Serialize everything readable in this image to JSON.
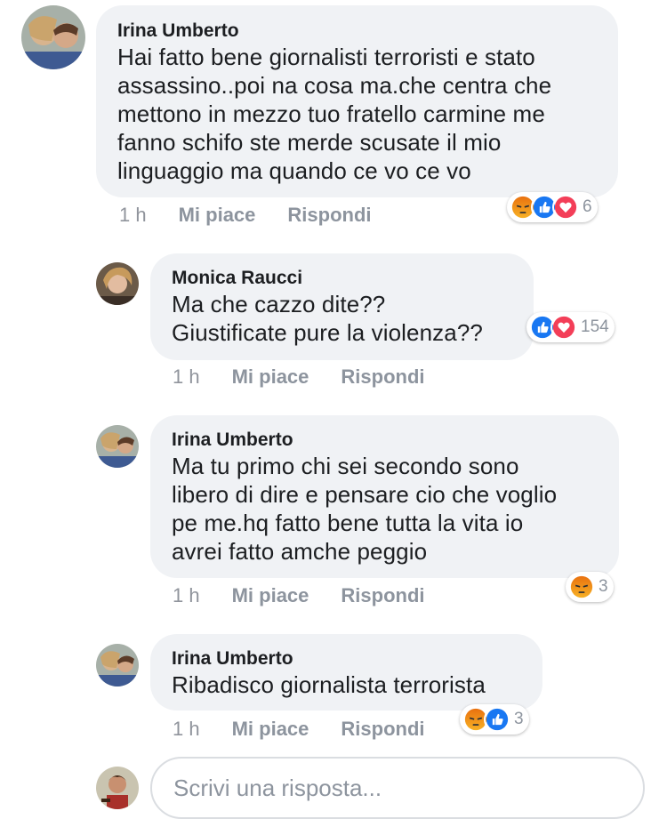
{
  "comments": [
    {
      "author": "Irina Umberto",
      "text": "Hai fatto bene giornalisti terroristi e stato\nassassino..poi na cosa ma.che centra che\nmettono in mezzo tuo fratello carmine me\nfanno schifo ste merde scusate il mio\nlinguaggio ma quando ce vo ce vo",
      "time": "1 h",
      "like_label": "Mi piace",
      "reply_label": "Rispondi",
      "reactions": [
        "angry",
        "like",
        "love"
      ],
      "reaction_count": "6"
    },
    {
      "author": "Monica Raucci",
      "text": "Ma che cazzo dite??\nGiustificate pure la violenza??",
      "time": "1 h",
      "like_label": "Mi piace",
      "reply_label": "Rispondi",
      "reactions": [
        "like",
        "love"
      ],
      "reaction_count": "154"
    },
    {
      "author": "Irina Umberto",
      "text": "Ma tu primo chi sei secondo sono\nlibero di dire e pensare cio che voglio\npe me.hq fatto bene tutta la vita io\navrei fatto amche peggio",
      "time": "1 h",
      "like_label": "Mi piace",
      "reply_label": "Rispondi",
      "reactions": [
        "angry"
      ],
      "reaction_count": "3"
    },
    {
      "author": "Irina Umberto",
      "text": "Ribadisco giornalista terrorista",
      "time": "1 h",
      "like_label": "Mi piace",
      "reply_label": "Rispondi",
      "reactions": [
        "angry",
        "like"
      ],
      "reaction_count": "3"
    }
  ],
  "reply_input": {
    "placeholder": "Scrivi una risposta..."
  },
  "colors": {
    "bubble": "#f0f2f5",
    "like_blue": "#1877f2",
    "love_red": "#f33e58",
    "angry_top": "#e9710f",
    "angry_bottom": "#f7b125",
    "meta_grey": "#8d949e"
  }
}
